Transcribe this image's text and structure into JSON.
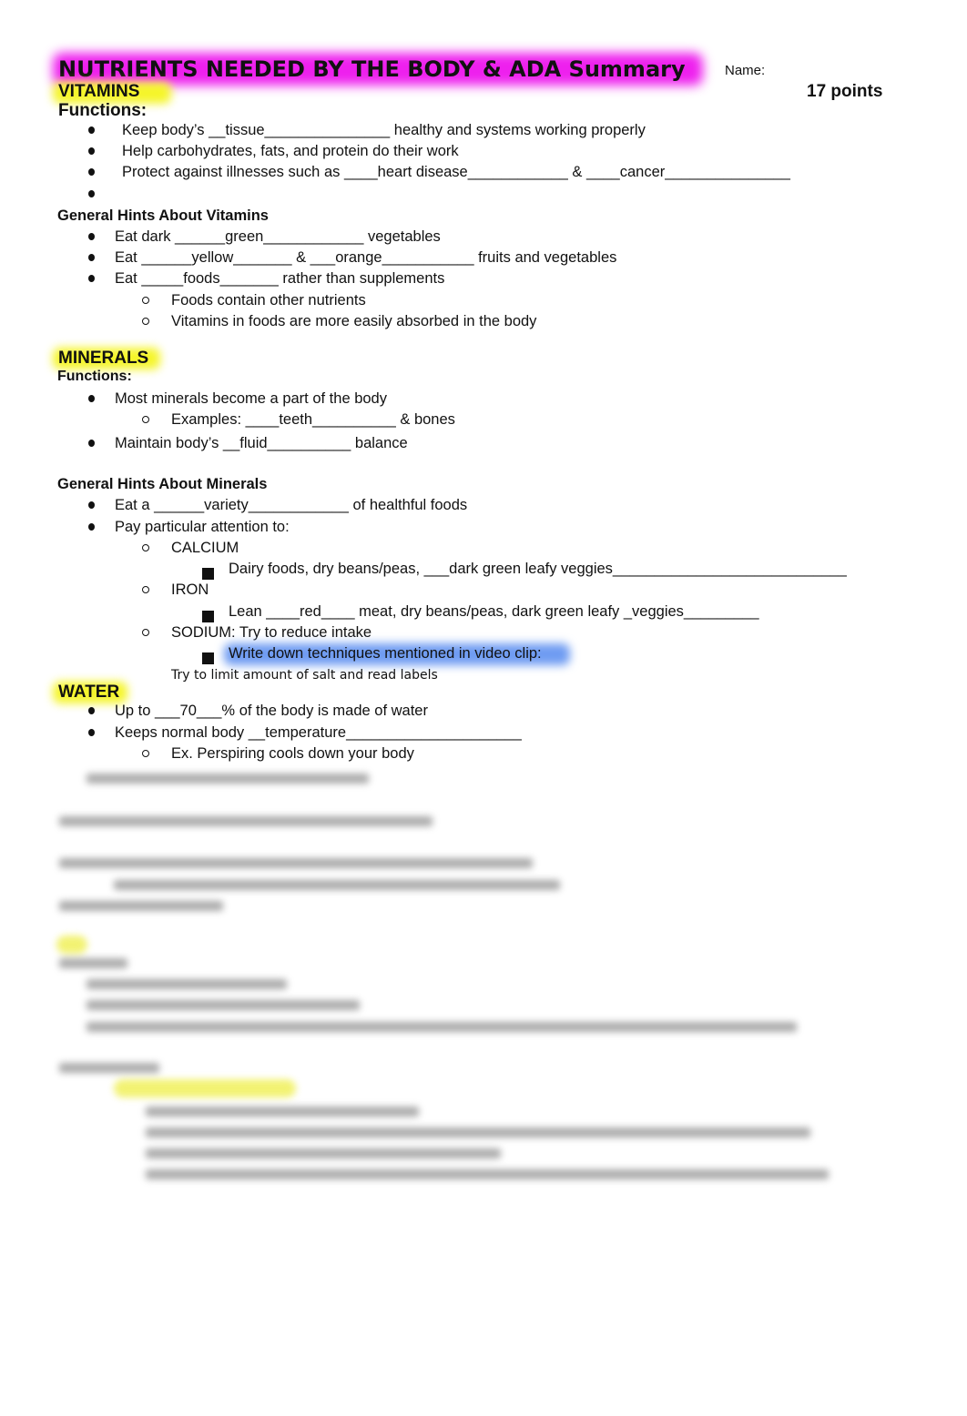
{
  "header": {
    "title": "NUTRIENTS NEEDED BY THE BODY & ADA Summary",
    "name_label": "Name:",
    "points": "17 points"
  },
  "vitamins": {
    "heading": "VITAMINS",
    "functions_label": "Functions:",
    "functions": [
      "Keep body’s __tissue_______________ healthy and systems working properly",
      "Help carbohydrates, fats, and protein do their work",
      "Protect against illnesses such as ____heart disease____________ & ____cancer_______________",
      ""
    ],
    "hints_heading": "General Hints About Vitamins",
    "hints": [
      "Eat dark ______green____________ vegetables",
      "Eat ______yellow_______ & ___orange___________ fruits and vegetables",
      "Eat _____foods_______ rather than supplements"
    ],
    "hint_subs": [
      "Foods contain other nutrients",
      "Vitamins in foods are more easily absorbed in the body"
    ]
  },
  "minerals": {
    "heading": "MINERALS",
    "functions_label": "Functions:",
    "functions": [
      "Most minerals become a part of the body",
      "Maintain body’s __fluid__________ balance"
    ],
    "function_sub": "Examples: ____teeth__________ & bones",
    "hints_heading": "General Hints About Minerals",
    "hints": [
      "Eat a ______variety____________ of healthful foods",
      "Pay particular attention to:"
    ],
    "calcium": "CALCIUM",
    "calcium_detail": "Dairy foods, dry beans/peas, ___dark green leafy veggies____________________________",
    "iron": "IRON",
    "iron_detail": "Lean ____red____ meat, dry beans/peas, dark green leafy _veggies_________",
    "sodium": "SODIUM: Try to reduce intake",
    "sodium_detail": "Write down techniques mentioned in video clip:",
    "sodium_answer": "Try to limit amount of salt and read labels"
  },
  "water": {
    "heading": "WATER",
    "items": [
      "Up to ___70___% of the body is made of water",
      "Keeps normal body __temperature_____________________"
    ],
    "sub": "Ex. Perspiring cools down your body"
  },
  "colors": {
    "title_highlight": "#ee20ee",
    "section_highlight": "#f5f52a",
    "note_highlight": "#6f9cf2"
  }
}
